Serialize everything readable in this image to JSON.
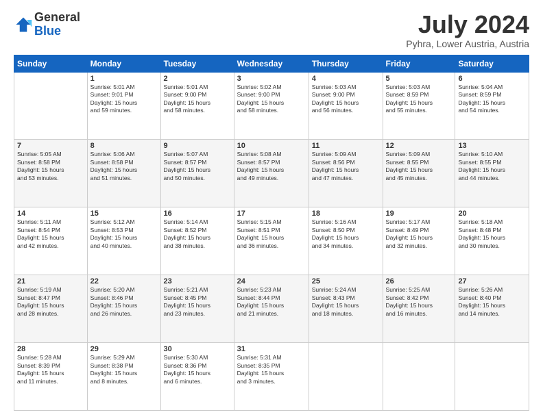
{
  "header": {
    "logo_general": "General",
    "logo_blue": "Blue",
    "month": "July 2024",
    "location": "Pyhra, Lower Austria, Austria"
  },
  "days_of_week": [
    "Sunday",
    "Monday",
    "Tuesday",
    "Wednesday",
    "Thursday",
    "Friday",
    "Saturday"
  ],
  "weeks": [
    [
      {
        "day": "",
        "info": ""
      },
      {
        "day": "1",
        "info": "Sunrise: 5:01 AM\nSunset: 9:01 PM\nDaylight: 15 hours\nand 59 minutes."
      },
      {
        "day": "2",
        "info": "Sunrise: 5:01 AM\nSunset: 9:00 PM\nDaylight: 15 hours\nand 58 minutes."
      },
      {
        "day": "3",
        "info": "Sunrise: 5:02 AM\nSunset: 9:00 PM\nDaylight: 15 hours\nand 58 minutes."
      },
      {
        "day": "4",
        "info": "Sunrise: 5:03 AM\nSunset: 9:00 PM\nDaylight: 15 hours\nand 56 minutes."
      },
      {
        "day": "5",
        "info": "Sunrise: 5:03 AM\nSunset: 8:59 PM\nDaylight: 15 hours\nand 55 minutes."
      },
      {
        "day": "6",
        "info": "Sunrise: 5:04 AM\nSunset: 8:59 PM\nDaylight: 15 hours\nand 54 minutes."
      }
    ],
    [
      {
        "day": "7",
        "info": "Sunrise: 5:05 AM\nSunset: 8:58 PM\nDaylight: 15 hours\nand 53 minutes."
      },
      {
        "day": "8",
        "info": "Sunrise: 5:06 AM\nSunset: 8:58 PM\nDaylight: 15 hours\nand 51 minutes."
      },
      {
        "day": "9",
        "info": "Sunrise: 5:07 AM\nSunset: 8:57 PM\nDaylight: 15 hours\nand 50 minutes."
      },
      {
        "day": "10",
        "info": "Sunrise: 5:08 AM\nSunset: 8:57 PM\nDaylight: 15 hours\nand 49 minutes."
      },
      {
        "day": "11",
        "info": "Sunrise: 5:09 AM\nSunset: 8:56 PM\nDaylight: 15 hours\nand 47 minutes."
      },
      {
        "day": "12",
        "info": "Sunrise: 5:09 AM\nSunset: 8:55 PM\nDaylight: 15 hours\nand 45 minutes."
      },
      {
        "day": "13",
        "info": "Sunrise: 5:10 AM\nSunset: 8:55 PM\nDaylight: 15 hours\nand 44 minutes."
      }
    ],
    [
      {
        "day": "14",
        "info": "Sunrise: 5:11 AM\nSunset: 8:54 PM\nDaylight: 15 hours\nand 42 minutes."
      },
      {
        "day": "15",
        "info": "Sunrise: 5:12 AM\nSunset: 8:53 PM\nDaylight: 15 hours\nand 40 minutes."
      },
      {
        "day": "16",
        "info": "Sunrise: 5:14 AM\nSunset: 8:52 PM\nDaylight: 15 hours\nand 38 minutes."
      },
      {
        "day": "17",
        "info": "Sunrise: 5:15 AM\nSunset: 8:51 PM\nDaylight: 15 hours\nand 36 minutes."
      },
      {
        "day": "18",
        "info": "Sunrise: 5:16 AM\nSunset: 8:50 PM\nDaylight: 15 hours\nand 34 minutes."
      },
      {
        "day": "19",
        "info": "Sunrise: 5:17 AM\nSunset: 8:49 PM\nDaylight: 15 hours\nand 32 minutes."
      },
      {
        "day": "20",
        "info": "Sunrise: 5:18 AM\nSunset: 8:48 PM\nDaylight: 15 hours\nand 30 minutes."
      }
    ],
    [
      {
        "day": "21",
        "info": "Sunrise: 5:19 AM\nSunset: 8:47 PM\nDaylight: 15 hours\nand 28 minutes."
      },
      {
        "day": "22",
        "info": "Sunrise: 5:20 AM\nSunset: 8:46 PM\nDaylight: 15 hours\nand 26 minutes."
      },
      {
        "day": "23",
        "info": "Sunrise: 5:21 AM\nSunset: 8:45 PM\nDaylight: 15 hours\nand 23 minutes."
      },
      {
        "day": "24",
        "info": "Sunrise: 5:23 AM\nSunset: 8:44 PM\nDaylight: 15 hours\nand 21 minutes."
      },
      {
        "day": "25",
        "info": "Sunrise: 5:24 AM\nSunset: 8:43 PM\nDaylight: 15 hours\nand 18 minutes."
      },
      {
        "day": "26",
        "info": "Sunrise: 5:25 AM\nSunset: 8:42 PM\nDaylight: 15 hours\nand 16 minutes."
      },
      {
        "day": "27",
        "info": "Sunrise: 5:26 AM\nSunset: 8:40 PM\nDaylight: 15 hours\nand 14 minutes."
      }
    ],
    [
      {
        "day": "28",
        "info": "Sunrise: 5:28 AM\nSunset: 8:39 PM\nDaylight: 15 hours\nand 11 minutes."
      },
      {
        "day": "29",
        "info": "Sunrise: 5:29 AM\nSunset: 8:38 PM\nDaylight: 15 hours\nand 8 minutes."
      },
      {
        "day": "30",
        "info": "Sunrise: 5:30 AM\nSunset: 8:36 PM\nDaylight: 15 hours\nand 6 minutes."
      },
      {
        "day": "31",
        "info": "Sunrise: 5:31 AM\nSunset: 8:35 PM\nDaylight: 15 hours\nand 3 minutes."
      },
      {
        "day": "",
        "info": ""
      },
      {
        "day": "",
        "info": ""
      },
      {
        "day": "",
        "info": ""
      }
    ]
  ]
}
